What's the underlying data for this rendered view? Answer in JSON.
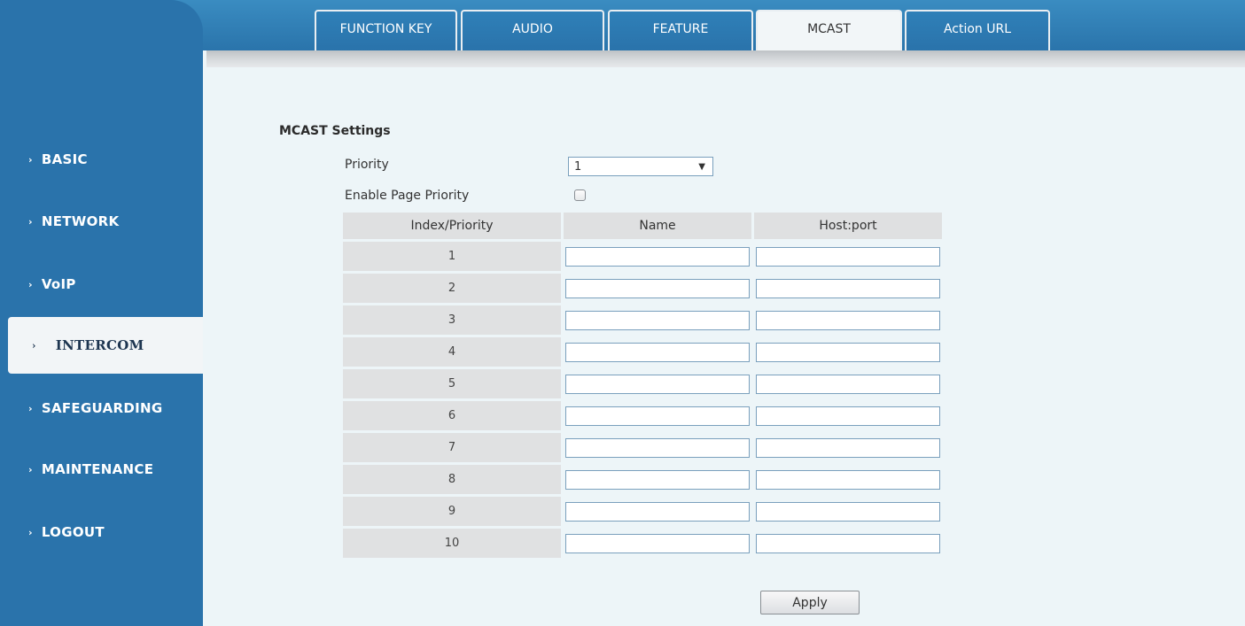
{
  "tabs": [
    {
      "label": "FUNCTION KEY",
      "active": false
    },
    {
      "label": "AUDIO",
      "active": false
    },
    {
      "label": "FEATURE",
      "active": false
    },
    {
      "label": "MCAST",
      "active": true
    },
    {
      "label": "Action URL",
      "active": false
    }
  ],
  "sidebar": {
    "items": [
      {
        "label": "BASIC"
      },
      {
        "label": "NETWORK"
      },
      {
        "label": "VoIP"
      },
      {
        "label": "INTERCOM",
        "active": true
      },
      {
        "label": "SAFEGUARDING"
      },
      {
        "label": "MAINTENANCE"
      },
      {
        "label": "LOGOUT"
      }
    ],
    "arrow": "›"
  },
  "settings": {
    "title": "MCAST Settings",
    "priority_label": "Priority",
    "priority_value": "1",
    "page_priority_label": "Enable Page Priority",
    "page_priority_checked": false
  },
  "table": {
    "headers": [
      "Index/Priority",
      "Name",
      "Host:port"
    ],
    "rows": [
      {
        "index": "1",
        "name": "",
        "host": ""
      },
      {
        "index": "2",
        "name": "",
        "host": ""
      },
      {
        "index": "3",
        "name": "",
        "host": ""
      },
      {
        "index": "4",
        "name": "",
        "host": ""
      },
      {
        "index": "5",
        "name": "",
        "host": ""
      },
      {
        "index": "6",
        "name": "",
        "host": ""
      },
      {
        "index": "7",
        "name": "",
        "host": ""
      },
      {
        "index": "8",
        "name": "",
        "host": ""
      },
      {
        "index": "9",
        "name": "",
        "host": ""
      },
      {
        "index": "10",
        "name": "",
        "host": ""
      }
    ]
  },
  "apply_label": "Apply",
  "colors": {
    "sidebar": "#2a73ab",
    "background": "#edf5f8"
  }
}
